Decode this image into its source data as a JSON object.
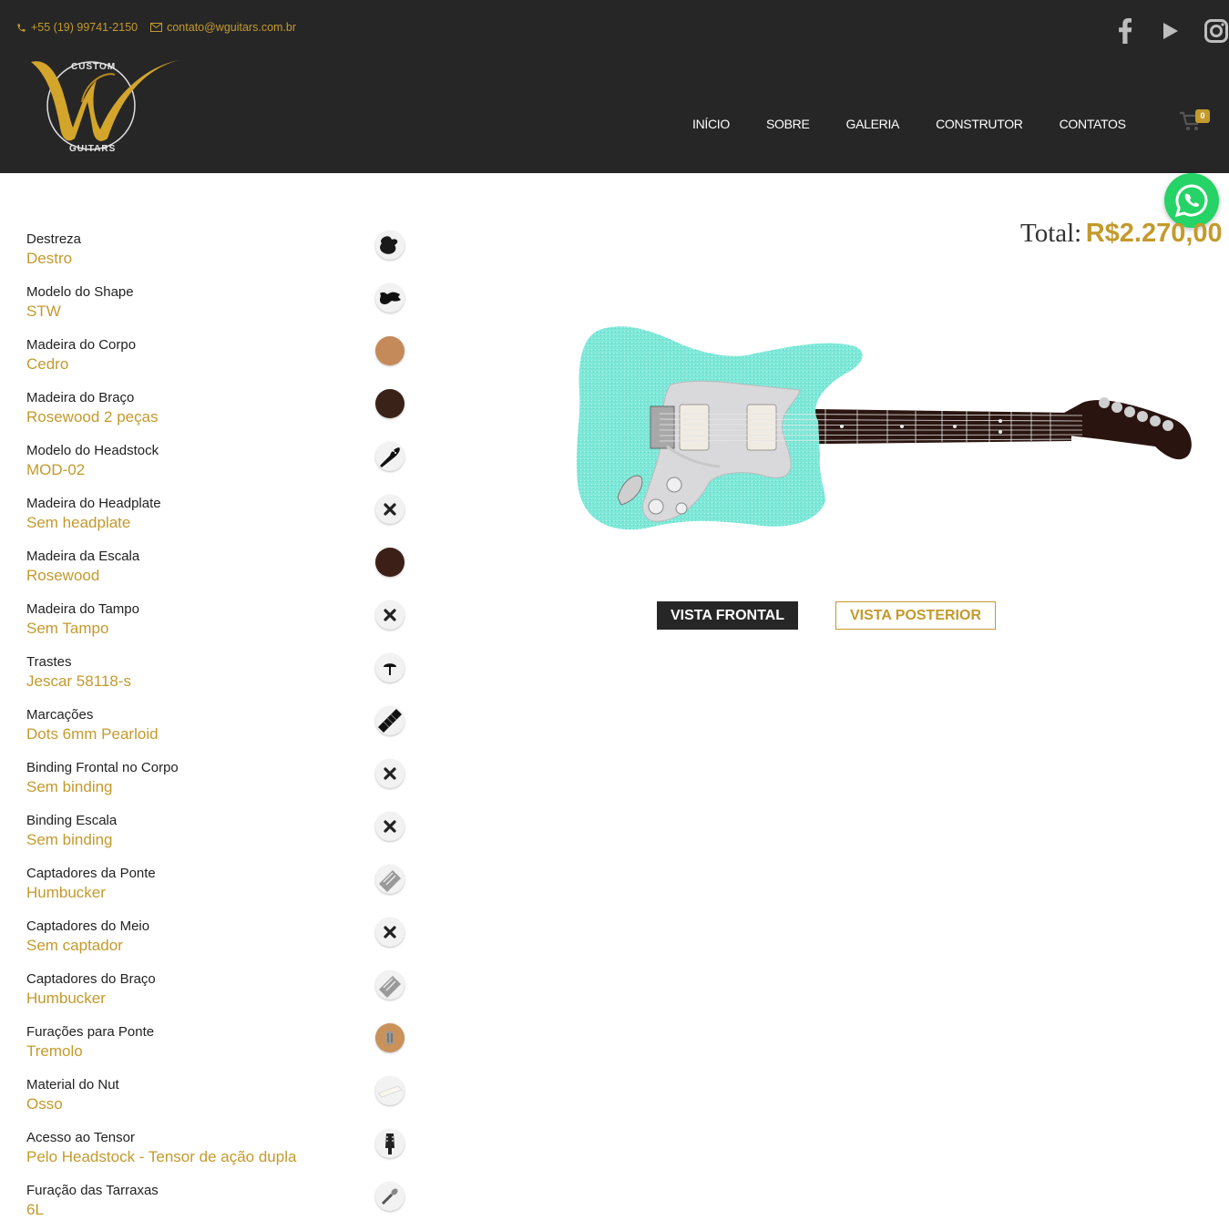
{
  "header": {
    "phone": "+55 (19) 99741-2150",
    "email": "contato@wguitars.com.br",
    "logo_text_top": "CUSTOM",
    "logo_text_bottom": "GUITARS",
    "nav": [
      "INÍCIO",
      "SOBRE",
      "GALERIA",
      "CONSTRUTOR",
      "CONTATOS"
    ],
    "cart_count": "0",
    "social": [
      "facebook-icon",
      "youtube-icon",
      "instagram-icon"
    ]
  },
  "total": {
    "label": "Total:",
    "value": "R$2.270,00"
  },
  "options": [
    {
      "label": "Destreza",
      "value": "Destro",
      "icon": "body-shape-icon"
    },
    {
      "label": "Modelo do Shape",
      "value": "STW",
      "icon": "strat-body-icon"
    },
    {
      "label": "Madeira do Corpo",
      "value": "Cedro",
      "icon": "wood-swatch-icon"
    },
    {
      "label": "Madeira do Braço",
      "value": "Rosewood 2 peças",
      "icon": "wood-swatch-icon"
    },
    {
      "label": "Modelo do Headstock",
      "value": "MOD-02",
      "icon": "headstock-icon"
    },
    {
      "label": "Madeira do Headplate",
      "value": "Sem headplate",
      "icon": "none-x-icon"
    },
    {
      "label": "Madeira da Escala",
      "value": "Rosewood",
      "icon": "wood-swatch-icon"
    },
    {
      "label": "Madeira do Tampo",
      "value": "Sem Tampo",
      "icon": "none-x-icon"
    },
    {
      "label": "Trastes",
      "value": "Jescar 58118-s",
      "icon": "fret-icon"
    },
    {
      "label": "Marcações",
      "value": "Dots 6mm Pearloid",
      "icon": "fretboard-icon"
    },
    {
      "label": "Binding Frontal no Corpo",
      "value": "Sem binding",
      "icon": "none-x-icon"
    },
    {
      "label": "Binding Escala",
      "value": "Sem binding",
      "icon": "none-x-icon"
    },
    {
      "label": "Captadores da Ponte",
      "value": "Humbucker",
      "icon": "humbucker-icon"
    },
    {
      "label": "Captadores do Meio",
      "value": "Sem captador",
      "icon": "none-x-icon"
    },
    {
      "label": "Captadores do Braço",
      "value": "Humbucker",
      "icon": "humbucker-icon"
    },
    {
      "label": "Furações para Ponte",
      "value": "Tremolo",
      "icon": "tremolo-icon"
    },
    {
      "label": "Material do Nut",
      "value": "Osso",
      "icon": "nut-icon"
    },
    {
      "label": "Acesso ao Tensor",
      "value": "Pelo Headstock - Tensor de ação dupla",
      "icon": "truss-rod-icon"
    },
    {
      "label": "Furação das Tarraxas",
      "value": "6L",
      "icon": "tuner-icon"
    }
  ],
  "buttons": {
    "front": "VISTA FRONTAL",
    "back": "VISTA POSTERIOR"
  },
  "colors": {
    "accent": "#c39a2c",
    "header_bg": "#262626",
    "body_color": "#7fe8d6",
    "whatsapp": "#25d366"
  }
}
